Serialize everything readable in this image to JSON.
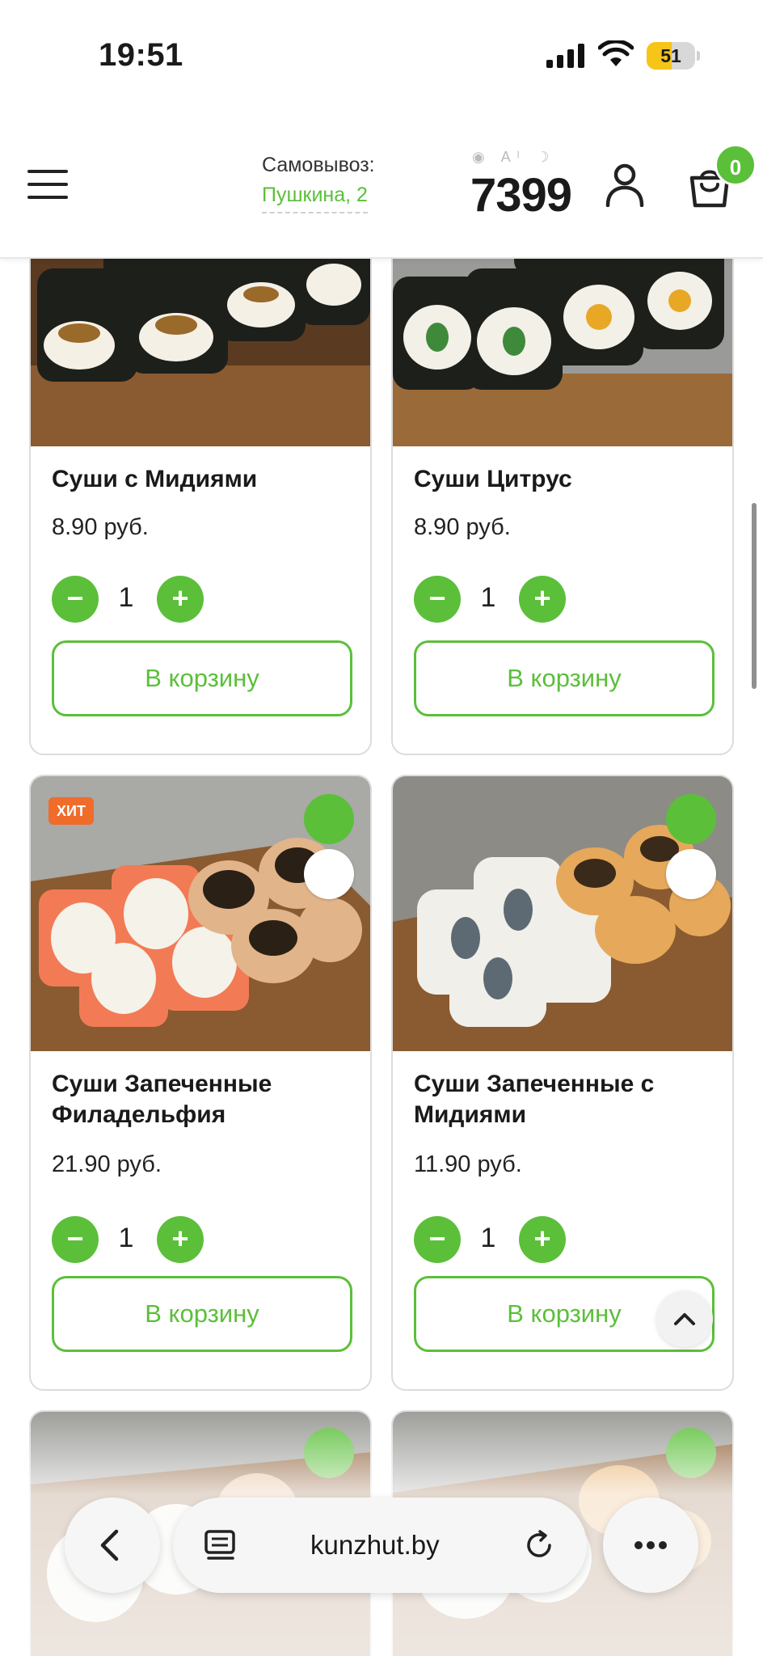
{
  "status_bar": {
    "time": "19:51",
    "battery_level": "51",
    "battery_fraction": 0.51
  },
  "header": {
    "pickup_label": "Самовывоз:",
    "pickup_address": "Пушкина, 2",
    "phone": "7399",
    "cart_count": "0",
    "icons": [
      "menu-icon",
      "user-icon",
      "cart-icon"
    ]
  },
  "products": [
    {
      "name": "Суши с Мидиями",
      "price": "8.90 руб.",
      "qty": "1",
      "cart_label": "В корзину",
      "hit": ""
    },
    {
      "name": "Суши Цитрус",
      "price": "8.90 руб.",
      "qty": "1",
      "cart_label": "В корзину",
      "hit": ""
    },
    {
      "name": "Суши Запеченные Филадельфия",
      "price": "21.90 руб.",
      "qty": "1",
      "cart_label": "В корзину",
      "hit": "ХИТ"
    },
    {
      "name": "Суши Запеченные с Мидиями",
      "price": "11.90 руб.",
      "qty": "1",
      "cart_label": "В корзину",
      "hit": ""
    }
  ],
  "controls": {
    "minus": "−",
    "plus": "+"
  },
  "browser": {
    "url": "kunzhut.by"
  },
  "colors": {
    "accent": "#5bbf3a",
    "hit_badge": "#ef6c2b",
    "battery": "#f5c518"
  }
}
